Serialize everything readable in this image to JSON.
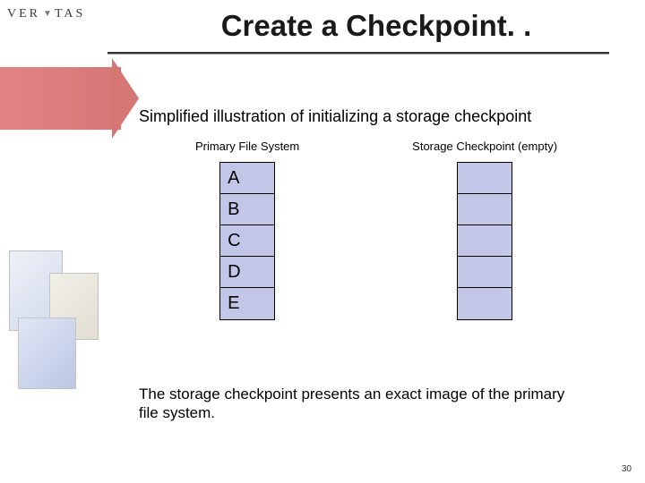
{
  "brand": {
    "name": "VERITAS"
  },
  "slide": {
    "title": "Create a Checkpoint. .",
    "subtitle": "Simplified illustration of initializing a storage checkpoint",
    "primary_label": "Primary File System",
    "checkpoint_label": "Storage Checkpoint (empty)",
    "primary_cells": [
      "A",
      "B",
      "C",
      "D",
      "E"
    ],
    "checkpoint_cells": [
      "",
      "",
      "",
      "",
      ""
    ],
    "footer": "The storage checkpoint presents an exact image of the primary file system.",
    "number": "30"
  }
}
